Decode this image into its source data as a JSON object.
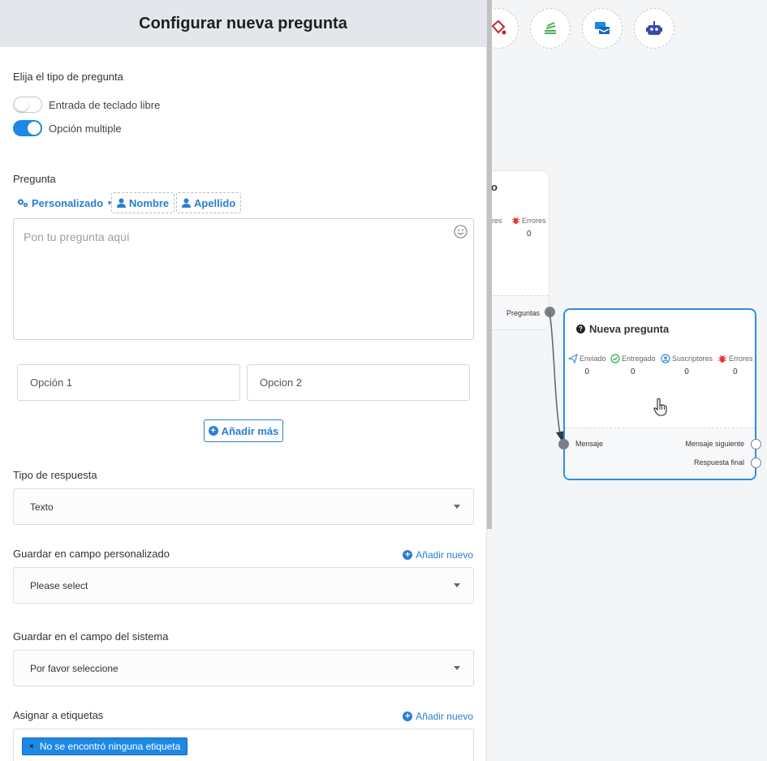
{
  "panel": {
    "title": "Configurar nueva pregunta",
    "question_type": {
      "label": "Elija el tipo de pregunta",
      "options": [
        {
          "label": "Entrada de teclado libre",
          "enabled": false
        },
        {
          "label": "Opción multiple",
          "enabled": true
        }
      ]
    },
    "question": {
      "label": "Pregunta",
      "vars": {
        "custom": "Personalizado",
        "first_name": "Nombre",
        "last_name": "Apellido"
      },
      "placeholder": "Pon tu pregunta aquí"
    },
    "choices": [
      "Opción 1",
      "Opcion 2"
    ],
    "add_more": "Añadir más",
    "response_type": {
      "label": "Tipo de respuesta",
      "value": "Texto"
    },
    "custom_field": {
      "label": "Guardar en campo personalizado",
      "add_new": "Añadir nuevo",
      "value": "Please select"
    },
    "system_field": {
      "label": "Guardar en el campo del sistema",
      "value": "Por favor seleccione"
    },
    "labels": {
      "label": "Asignar a etiquetas",
      "add_new": "Añadir nuevo",
      "tag": "No se encontró ninguna etiqueta",
      "tag_remove": "×"
    }
  },
  "canvas": {
    "toolbar_icons": [
      "paint-bucket-icon",
      "stack-icon",
      "messages-icon",
      "robot-icon"
    ],
    "prev_node": {
      "title_fragment": "o",
      "stat_fragment": "ores",
      "errors_label": "Errores",
      "errors_value": "0",
      "port_label": "Preguntas"
    },
    "node": {
      "title": "Nueva pregunta",
      "stats": [
        {
          "label": "Enviado",
          "value": "0",
          "icon": "send-icon",
          "color": "#3a8fd9"
        },
        {
          "label": "Entregado",
          "value": "0",
          "icon": "check-circle-icon",
          "color": "#2bab4a"
        },
        {
          "label": "Suscriptores",
          "value": "0",
          "icon": "user-circle-icon",
          "color": "#3a8fd9"
        },
        {
          "label": "Errores",
          "value": "0",
          "icon": "bug-icon",
          "color": "#e53935"
        }
      ],
      "ports": {
        "input": "Mensaje",
        "next": "Mensaje siguiente",
        "final": "Respuesta final"
      }
    }
  }
}
